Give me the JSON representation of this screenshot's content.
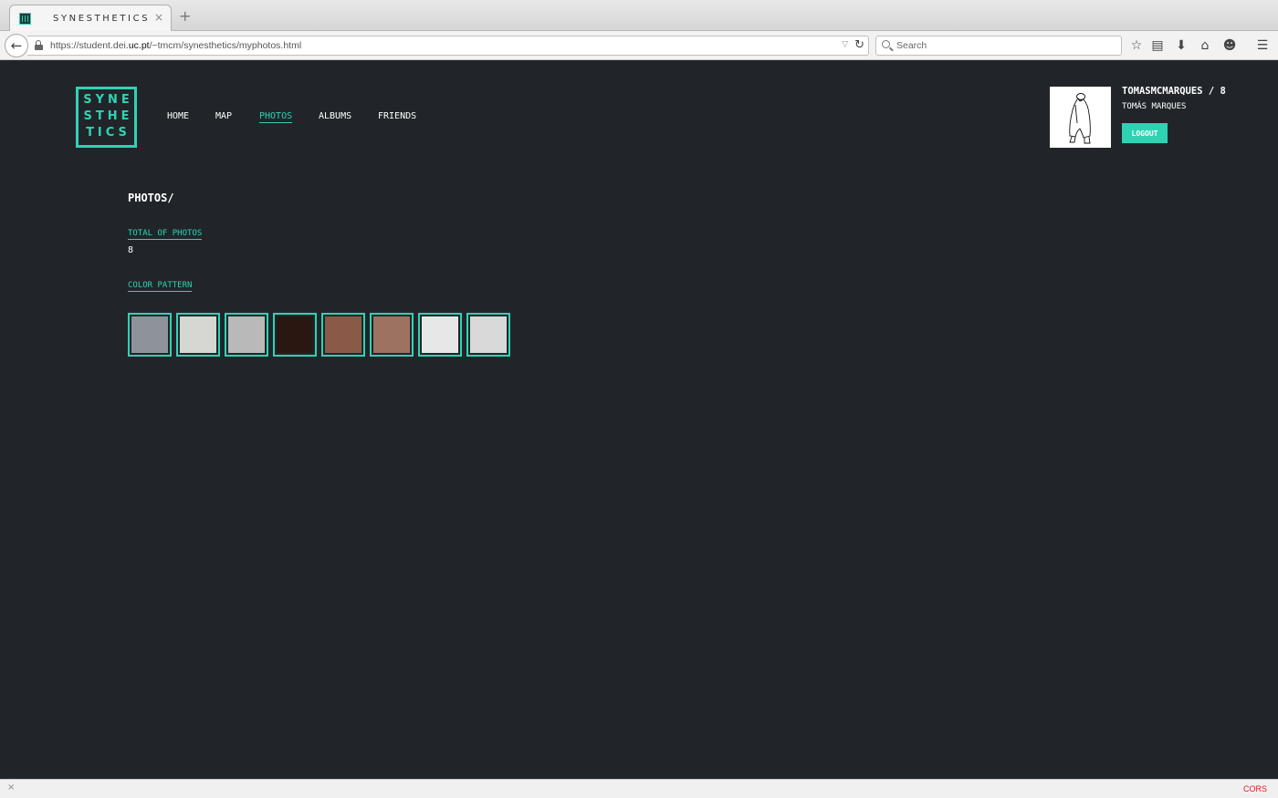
{
  "browser": {
    "tab_title": "SYNESTHETICS",
    "tab_close": "×",
    "new_tab": "+",
    "url_prefix": "https://student.dei.",
    "url_domain": "uc.pt",
    "url_path": "/~tmcm/synesthetics/myphotos.html",
    "search_placeholder": "Search",
    "status_close": "×",
    "status_badge": "CORS"
  },
  "logo": {
    "lines": [
      "SYNE",
      "STHE",
      "TICS"
    ]
  },
  "nav": {
    "items": [
      {
        "label": "HOME",
        "active": false
      },
      {
        "label": "MAP",
        "active": false
      },
      {
        "label": "PHOTOS",
        "active": true
      },
      {
        "label": "ALBUMS",
        "active": false
      },
      {
        "label": "FRIENDS",
        "active": false
      }
    ]
  },
  "user": {
    "username_count": "TOMASMCMARQUES / 8",
    "full_name": "TOMÁS MARQUES",
    "logout_label": "LOGOUT"
  },
  "main": {
    "title": "PHOTOS/",
    "total_label": "TOTAL OF PHOTOS",
    "total_value": "8",
    "color_label": "COLOR PATTERN",
    "color_pattern": [
      "#8e939b",
      "#d6d6d2",
      "#b9b9b9",
      "#2a1712",
      "#8a5a49",
      "#9e7261",
      "#e7e7e7",
      "#d9d9d9"
    ]
  },
  "colors": {
    "accent": "#2ed3b4",
    "background": "#212529"
  }
}
